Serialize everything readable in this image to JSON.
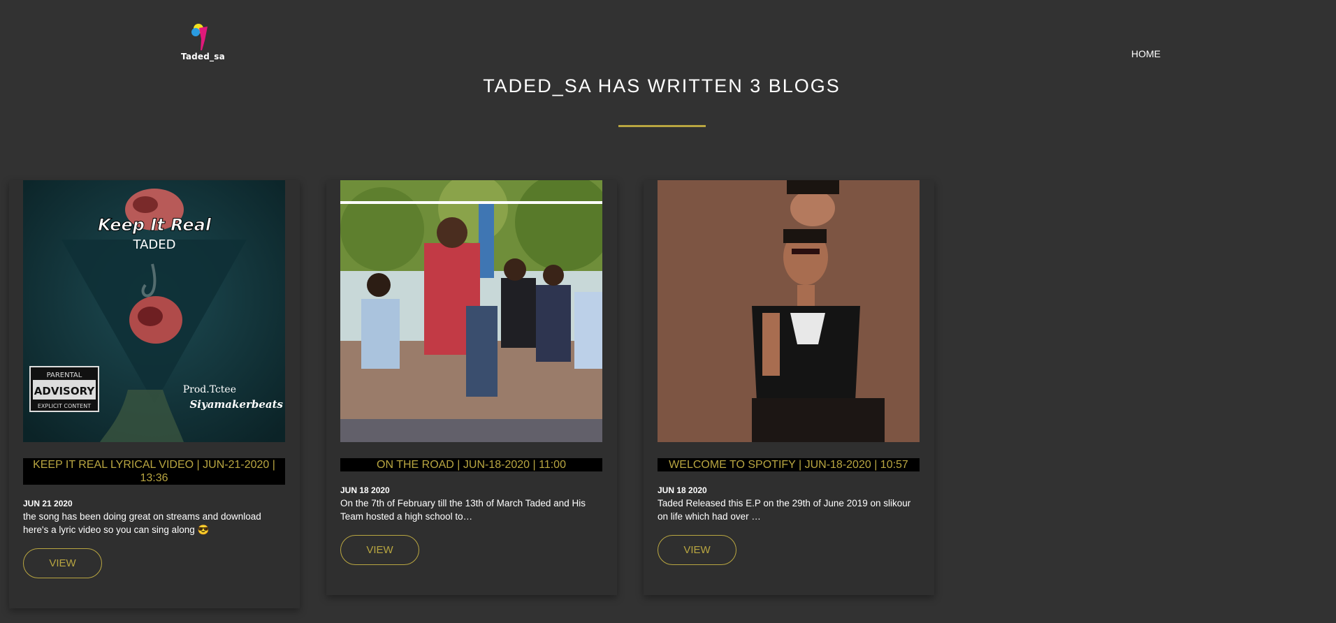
{
  "site": {
    "logo_text": "Taded_sa",
    "nav_home": "HOME",
    "page_title": "TADED_SA HAS WRITTEN 3 BLOGS"
  },
  "colors": {
    "background": "#323232",
    "accent": "#b9a641",
    "title_bar": "#000000"
  },
  "posts": [
    {
      "image_text": {
        "title": "Keep It Real",
        "artist": "TADED",
        "prod": "Prod.Tctee",
        "label": "Siyamakerbeats",
        "advisory_top": "PARENTAL",
        "advisory_mid": "ADVISORY",
        "advisory_bottom": "EXPLICIT CONTENT"
      },
      "title": "KEEP IT REAL LYRICAL VIDEO | JUN-21-2020 | 13:36",
      "date": "JUN 21 2020",
      "excerpt": "the song has been doing great on streams and download here's a lyric video so you can sing along 😎",
      "button": "VIEW"
    },
    {
      "title": "ON THE ROAD | JUN-18-2020 | 11:00",
      "date": "JUN 18 2020",
      "excerpt": "On the 7th of February till the 13th of March Taded and His Team hosted a high school to…",
      "button": "VIEW"
    },
    {
      "title": "WELCOME TO SPOTIFY | JUN-18-2020 | 10:57",
      "date": "JUN 18 2020",
      "excerpt": "Taded Released this E.P on the 29th of June 2019 on slikour on life which had over …",
      "button": "VIEW"
    }
  ]
}
